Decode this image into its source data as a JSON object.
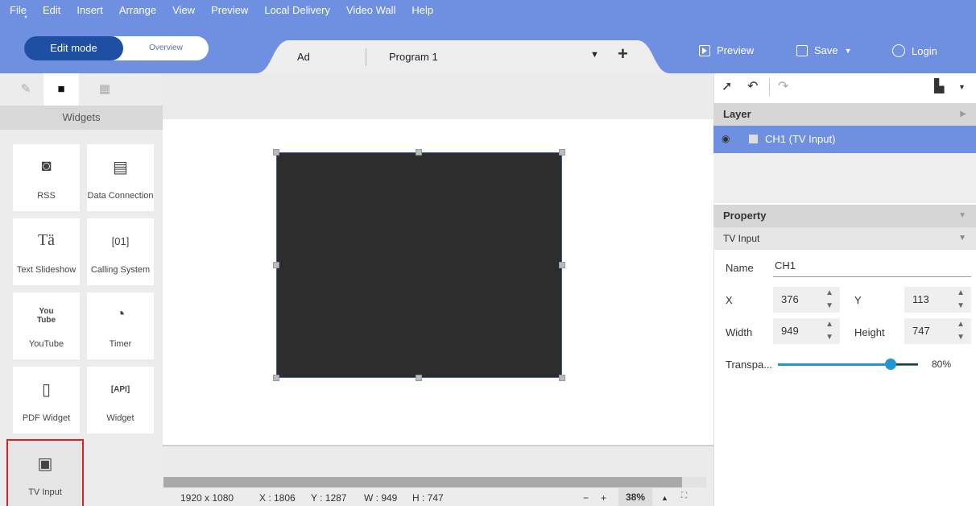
{
  "menu": [
    "File",
    "Edit",
    "Insert",
    "Arrange",
    "View",
    "Preview",
    "Local Delivery",
    "Video Wall",
    "Help"
  ],
  "mode": {
    "edit": "Edit mode",
    "overview": "Overview"
  },
  "program_tab": {
    "ad": "Ad",
    "program": "Program 1",
    "add": "+"
  },
  "header_actions": {
    "preview": "Preview",
    "save": "Save",
    "login": "Login"
  },
  "left_panel": {
    "title": "Widgets",
    "widgets": [
      {
        "label": "RSS",
        "icon": "rss-icon"
      },
      {
        "label": "Data Connection",
        "icon": "data-connection-icon"
      },
      {
        "label": "Text Slideshow",
        "icon": "text-slideshow-icon"
      },
      {
        "label": "Calling System",
        "icon": "calling-system-icon"
      },
      {
        "label": "YouTube",
        "icon": "youtube-icon"
      },
      {
        "label": "Timer",
        "icon": "timer-icon"
      },
      {
        "label": "PDF Widget",
        "icon": "pdf-icon"
      },
      {
        "label": "Widget",
        "icon": "api-icon"
      },
      {
        "label": "TV Input",
        "icon": "tv-input-icon",
        "selected": true
      }
    ]
  },
  "status": {
    "resolution": "1920 x 1080",
    "x": "X : 1806",
    "y": "Y : 1287",
    "w": "W : 949",
    "h": "H : 747",
    "zoom_minus": "−",
    "zoom_plus": "+",
    "zoom": "38%"
  },
  "layer": {
    "title": "Layer",
    "item": "CH1 (TV Input)"
  },
  "property": {
    "title": "Property",
    "type": "TV Input",
    "name_label": "Name",
    "name_value": "CH1",
    "x_label": "X",
    "x_value": "376",
    "y_label": "Y",
    "y_value": "113",
    "width_label": "Width",
    "width_value": "949",
    "height_label": "Height",
    "height_value": "747",
    "transparency_label": "Transpa...",
    "transparency_value": "80%",
    "transparency_level": 0.8
  },
  "colors": {
    "header": "#6f8fe0",
    "accent": "#1f4fa3",
    "slider": "#2196d3",
    "selection": "#e02020"
  }
}
